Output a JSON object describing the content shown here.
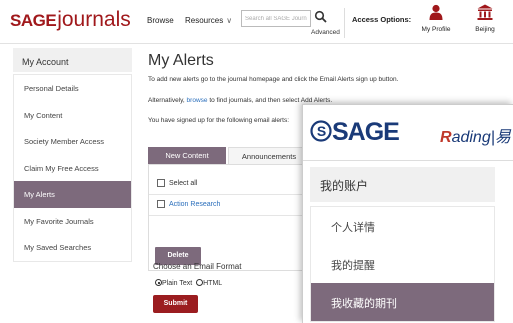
{
  "header": {
    "logo_sage": "SAGE",
    "logo_journals": "journals",
    "nav_browse": "Browse",
    "nav_resources": "Resources",
    "search_placeholder": "Search all SAGE Journals",
    "advanced": "Advanced",
    "access_options": "Access Options:",
    "my_profile": "My Profile",
    "institution": "Beijing",
    "icons": [
      "search-icon",
      "user-icon",
      "institution-icon",
      "chevron-down-icon"
    ],
    "colors": {
      "brand": "#a0181b"
    }
  },
  "sidebar": {
    "heading": "My Account",
    "items": [
      {
        "label": "Personal Details"
      },
      {
        "label": "My Content"
      },
      {
        "label": "Society Member Access"
      },
      {
        "label": "Claim My Free Access"
      },
      {
        "label": "My Alerts",
        "active": true
      },
      {
        "label": "My Favorite Journals"
      },
      {
        "label": "My Saved Searches"
      }
    ],
    "active_color": "#7d6a7c"
  },
  "main": {
    "title": "My Alerts",
    "line1": "To add new alerts go to the journal homepage and click the Email Alerts sign up button.",
    "line2_pre": "Alternatively,",
    "line2_link": "browse",
    "line2_post": "to find journals, and then select Add Alerts.",
    "line3": "You have signed up for the following email alerts:",
    "tabs": [
      {
        "label": "New Content",
        "active": true
      },
      {
        "label": "Announcements"
      }
    ],
    "select_all": "Select all",
    "alert_item": "Action Research",
    "delete": "Delete",
    "email_format_title": "Choose an Email Format",
    "format_plain": "Plain Text",
    "format_html": "HTML",
    "format_selected": "Plain Text",
    "submit": "Submit",
    "submit_color": "#9b1d20"
  },
  "overlay": {
    "logo": "SAGE",
    "reading_logo_r": "R",
    "reading_logo_rest": "ading",
    "reading_logo_cn": "|易",
    "heading": "我的账户",
    "items": [
      {
        "label": "个人详情"
      },
      {
        "label": "我的提醒"
      },
      {
        "label": "我收藏的期刊",
        "active": true
      }
    ],
    "colors": {
      "logo": "#1a3a78",
      "accent": "#c0392b"
    }
  }
}
